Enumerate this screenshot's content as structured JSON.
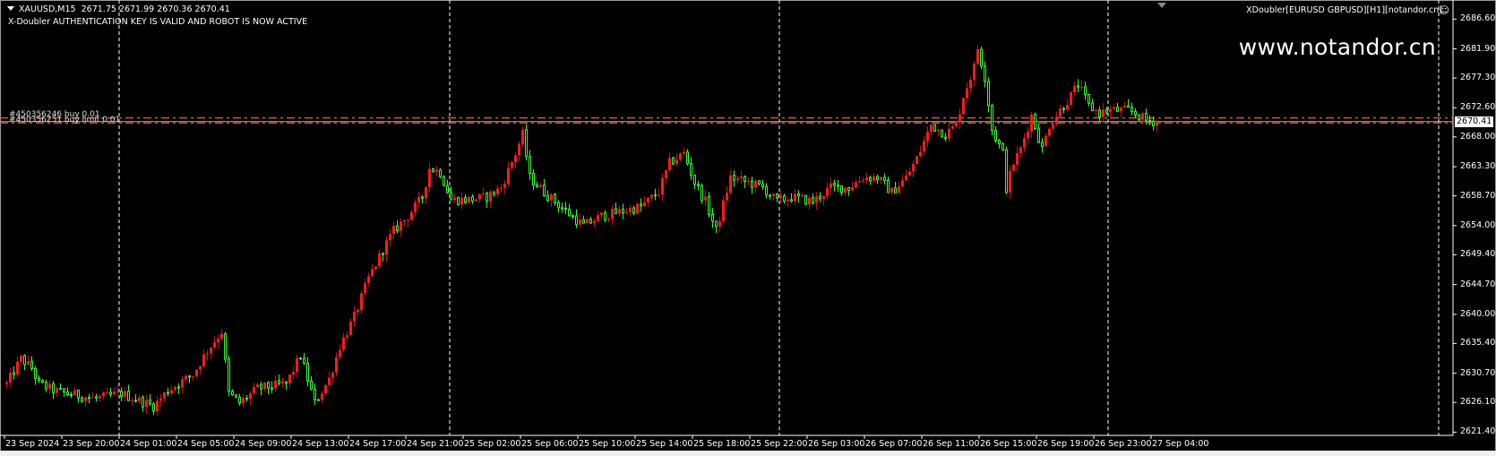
{
  "header": {
    "symbol": "XAUUSD,M15",
    "ohlc": "2671.75 2671.99 2670.36 2670.41",
    "auth_message": "X-Doubler AUTHENTICATION KEY IS VALID AND ROBOT IS NOW ACTIVE"
  },
  "expert": {
    "label": "XDoubler[EURUSD GBPUSD][H1][notandor.cn]",
    "status_icon": "smiley-icon",
    "watermark": "www.notandor.cn"
  },
  "orders": [
    {
      "label": "#450356246 buy 0.01",
      "price": 2671.0
    },
    {
      "label": "#450356251 buy limit 0.01",
      "price": 2670.2
    }
  ],
  "current_price": "2670.41",
  "colors": {
    "background": "#000000",
    "bull": "#ff1a1a",
    "bear": "#33ff33",
    "order_line": "#e8603c",
    "bid_line": "#b0b0b0",
    "grid": "#ffffff"
  },
  "chart_data": {
    "type": "candlestick",
    "timeframe": "M15",
    "price_ticks": [
      "2686.60",
      "2681.90",
      "2677.30",
      "2672.60",
      "2668.00",
      "2663.30",
      "2658.70",
      "2654.00",
      "2649.40",
      "2644.70",
      "2640.00",
      "2635.40",
      "2630.70",
      "2626.10",
      "2621.40"
    ],
    "time_ticks": [
      "23 Sep 2024",
      "23 Sep 20:00",
      "24 Sep 01:00",
      "24 Sep 05:00",
      "24 Sep 09:00",
      "24 Sep 13:00",
      "24 Sep 17:00",
      "24 Sep 21:00",
      "25 Sep 02:00",
      "25 Sep 06:00",
      "25 Sep 10:00",
      "25 Sep 14:00",
      "25 Sep 18:00",
      "25 Sep 22:00",
      "26 Sep 03:00",
      "26 Sep 07:00",
      "26 Sep 11:00",
      "26 Sep 15:00",
      "26 Sep 19:00",
      "26 Sep 23:00",
      "27 Sep 04:00"
    ],
    "ylim": [
      2621.4,
      2686.6
    ],
    "candle_count": 322,
    "close_path": [
      [
        0,
        2629
      ],
      [
        4,
        2633
      ],
      [
        7,
        2631.5
      ],
      [
        9,
        2629
      ],
      [
        14,
        2627.8
      ],
      [
        25,
        2626.7
      ],
      [
        32,
        2627.5
      ],
      [
        41,
        2625.5
      ],
      [
        45,
        2628
      ],
      [
        52,
        2630.5
      ],
      [
        56,
        2634.3
      ],
      [
        60,
        2637.3
      ],
      [
        62,
        2627.5
      ],
      [
        65,
        2626
      ],
      [
        70,
        2628.3
      ],
      [
        78,
        2629
      ],
      [
        82,
        2633.5
      ],
      [
        86,
        2626
      ],
      [
        90,
        2629.8
      ],
      [
        93,
        2635
      ],
      [
        97,
        2639.6
      ],
      [
        101,
        2645.7
      ],
      [
        105,
        2650.2
      ],
      [
        108,
        2653.2
      ],
      [
        112,
        2655.5
      ],
      [
        116,
        2658.5
      ],
      [
        118,
        2663.1
      ],
      [
        121,
        2662.4
      ],
      [
        124,
        2658.1
      ],
      [
        129,
        2658.1
      ],
      [
        134,
        2658.5
      ],
      [
        138,
        2660
      ],
      [
        142,
        2665.4
      ],
      [
        144,
        2668.4
      ],
      [
        146,
        2661.6
      ],
      [
        150,
        2659.3
      ],
      [
        156,
        2656.3
      ],
      [
        161,
        2654
      ],
      [
        166,
        2655.5
      ],
      [
        172,
        2656.3
      ],
      [
        177,
        2657
      ],
      [
        182,
        2659.3
      ],
      [
        185,
        2663.9
      ],
      [
        189,
        2665.4
      ],
      [
        192,
        2660.8
      ],
      [
        195,
        2657.8
      ],
      [
        198,
        2653.2
      ],
      [
        202,
        2661.6
      ],
      [
        207,
        2660.8
      ],
      [
        211,
        2660
      ],
      [
        215,
        2657.8
      ],
      [
        219,
        2658.5
      ],
      [
        225,
        2657.8
      ],
      [
        230,
        2660
      ],
      [
        235,
        2660
      ],
      [
        239,
        2661.6
      ],
      [
        243,
        2661.6
      ],
      [
        247,
        2659.3
      ],
      [
        251,
        2661.6
      ],
      [
        254,
        2664.6
      ],
      [
        258,
        2669.9
      ],
      [
        262,
        2668.4
      ],
      [
        265,
        2669.9
      ],
      [
        267,
        2674.5
      ],
      [
        270,
        2679
      ],
      [
        271,
        2682
      ],
      [
        273,
        2677.5
      ],
      [
        275,
        2669.2
      ],
      [
        278,
        2665.4
      ],
      [
        279,
        2660
      ],
      [
        281,
        2663.9
      ],
      [
        283,
        2666.1
      ],
      [
        286,
        2671.4
      ],
      [
        289,
        2666.1
      ],
      [
        291,
        2669.9
      ],
      [
        294,
        2672.2
      ],
      [
        297,
        2674.5
      ],
      [
        299,
        2676.3
      ],
      [
        302,
        2672.9
      ],
      [
        305,
        2671.7
      ],
      [
        307,
        2672.2
      ],
      [
        310,
        2672.2
      ],
      [
        313,
        2672.2
      ],
      [
        315,
        2671.7
      ],
      [
        318,
        2670.6
      ],
      [
        321,
        2670.4
      ]
    ]
  }
}
